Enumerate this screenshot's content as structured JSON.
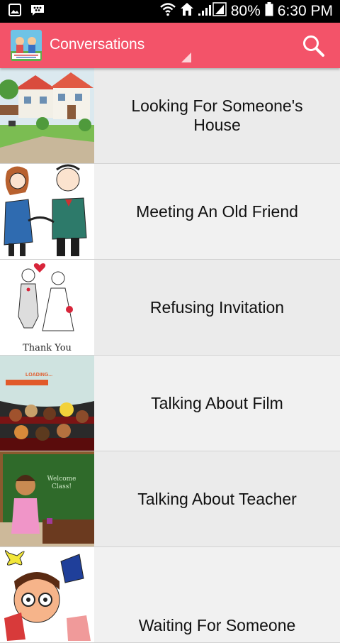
{
  "status_bar": {
    "battery": "80%",
    "time": "6:30 PM",
    "icons": [
      "gallery-icon",
      "bbm-icon",
      "wifi-icon",
      "home-signal-icon",
      "cell-signal-icon",
      "battery-icon"
    ]
  },
  "app_bar": {
    "title": "Conversations",
    "logo_icon": "english-conversation-logo",
    "search_icon": "search-icon",
    "color": "#f35369"
  },
  "conversations": [
    {
      "title": "Looking For Someone's House",
      "thumbnail": "house-illustration"
    },
    {
      "title": "Meeting An Old Friend",
      "thumbnail": "handshake-illustration"
    },
    {
      "title": "Refusing Invitation",
      "thumbnail": "wedding-couple-illustration",
      "thumbnail_caption": "Thank You"
    },
    {
      "title": "Talking About Film",
      "thumbnail": "cinema-audience-illustration",
      "thumbnail_caption": "LOADING..."
    },
    {
      "title": "Talking About Teacher",
      "thumbnail": "teacher-blackboard-illustration",
      "thumbnail_caption": "Welcome Class!"
    },
    {
      "title": "Waiting For Someone",
      "thumbnail": "waiting-person-illustration"
    }
  ]
}
